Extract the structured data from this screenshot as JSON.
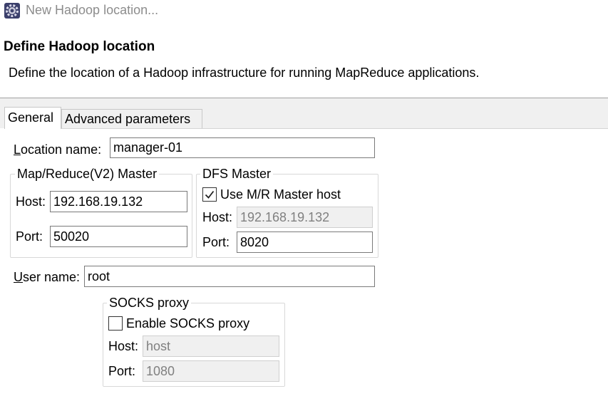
{
  "window": {
    "title": "New Hadoop location...",
    "icon": "eclipse-gear-icon"
  },
  "header": {
    "title": "Define Hadoop location",
    "description": "Define the location of a Hadoop infrastructure for running MapReduce applications."
  },
  "tabs": [
    {
      "label": "General",
      "selected": true
    },
    {
      "label": "Advanced parameters",
      "selected": false
    }
  ],
  "general": {
    "location_name": {
      "label_first": "L",
      "label_rest": "ocation name:",
      "value": "manager-01"
    },
    "mr_master": {
      "title": "Map/Reduce(V2) Master",
      "host_label": "Host:",
      "host_value": "192.168.19.132",
      "port_label": "Port:",
      "port_value": "50020"
    },
    "dfs_master": {
      "title": "DFS Master",
      "use_mr_label": "Use M/R Master host",
      "use_mr_checked": true,
      "host_label": "Host:",
      "host_value": "192.168.19.132",
      "port_label": "Port:",
      "port_value": "8020"
    },
    "user_name": {
      "label_first": "U",
      "label_rest": "ser name:",
      "value": "root"
    },
    "socks_proxy": {
      "title": "SOCKS proxy",
      "enable_label": "Enable SOCKS proxy",
      "enable_checked": false,
      "host_label": "Host:",
      "host_value": "host",
      "port_label": "Port:",
      "port_value": "1080"
    }
  }
}
